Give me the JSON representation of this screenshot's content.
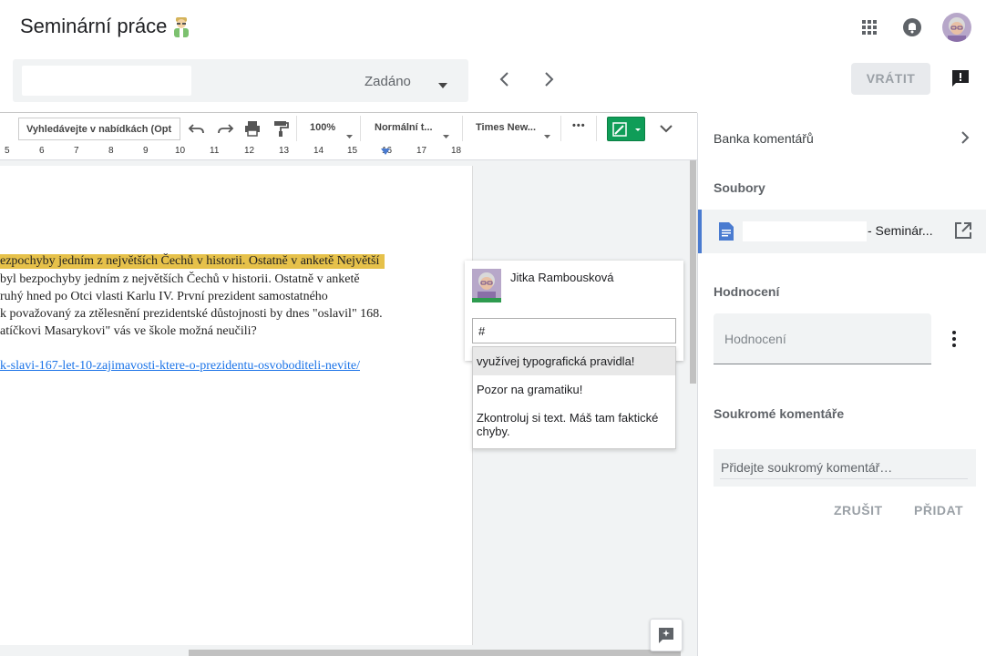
{
  "header": {
    "title": "Seminární práce",
    "emoji_icon": "student-avatar-icon"
  },
  "grade_bar": {
    "student_name": "",
    "status": "Zadáno",
    "return_label": "VRÁTIT"
  },
  "toolbar": {
    "menu_search": "Vyhledávejte v nabídkách (Opt",
    "zoom": "100%",
    "style": "Normální t...",
    "font": "Times New...",
    "more": "•••"
  },
  "ruler": {
    "ticks": [
      "5",
      "6",
      "7",
      "8",
      "9",
      "10",
      "11",
      "12",
      "13",
      "14",
      "15",
      "16",
      "17",
      "18"
    ]
  },
  "document": {
    "lines": [
      "ezpochyby jedním z největších Čechů v historii. Ostatně v anketě Největší",
      "byl bezpochyby jedním z největších Čechů v historii. Ostatně v anketě",
      "ruhý hned po Otci vlasti Karlu IV. První prezident samostatného",
      "k považovaný za ztělesnění prezidentské důstojnosti by dnes \"oslavil\" 168.",
      "atíčkovi Masarykovi\" vás ve škole možná neučili?"
    ],
    "link": "k-slavi-167-let-10-zajimavosti-ktere-o-prezidentu-osvoboditeli-nevite/"
  },
  "comment": {
    "author": "Jitka Rambousková",
    "input_value": "#",
    "suggestions": [
      "využívej typografická pravidla!",
      "Pozor na gramatiku!",
      "Zkontroluj si text. Máš tam faktické chyby."
    ]
  },
  "panel": {
    "bank_label": "Banka komentářů",
    "files_heading": "Soubory",
    "file_name": "- Seminár...",
    "grade_heading": "Hodnocení",
    "grade_placeholder": "Hodnocení",
    "private_heading": "Soukromé komentáře",
    "private_placeholder": "Přidejte soukromý komentář…",
    "cancel_label": "ZRUŠIT",
    "add_label": "PŘIDAT"
  },
  "colors": {
    "highlight": "#e6c14a",
    "edit_mode_green": "#0f9d58",
    "file_accent": "#4a7bd0",
    "link": "#1a73e8"
  }
}
